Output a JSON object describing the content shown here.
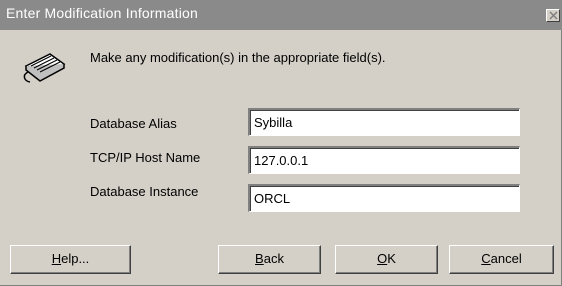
{
  "window": {
    "title": "Enter Modification Information",
    "close_icon": "close-icon"
  },
  "instruction": "Make any modification(s) in the appropriate field(s).",
  "header_icon": "keyboard-icon",
  "fields": [
    {
      "label": "Database Alias",
      "value": "Sybilla"
    },
    {
      "label": "TCP/IP Host Name",
      "value": "127.0.0.1"
    },
    {
      "label": "Database Instance",
      "value": "ORCL"
    }
  ],
  "buttons": {
    "help": {
      "mnemonic": "H",
      "rest": "elp..."
    },
    "back": {
      "mnemonic": "B",
      "rest": "ack"
    },
    "ok": {
      "mnemonic": "O",
      "rest": "K"
    },
    "cancel": {
      "mnemonic": "C",
      "rest": "ancel"
    }
  }
}
